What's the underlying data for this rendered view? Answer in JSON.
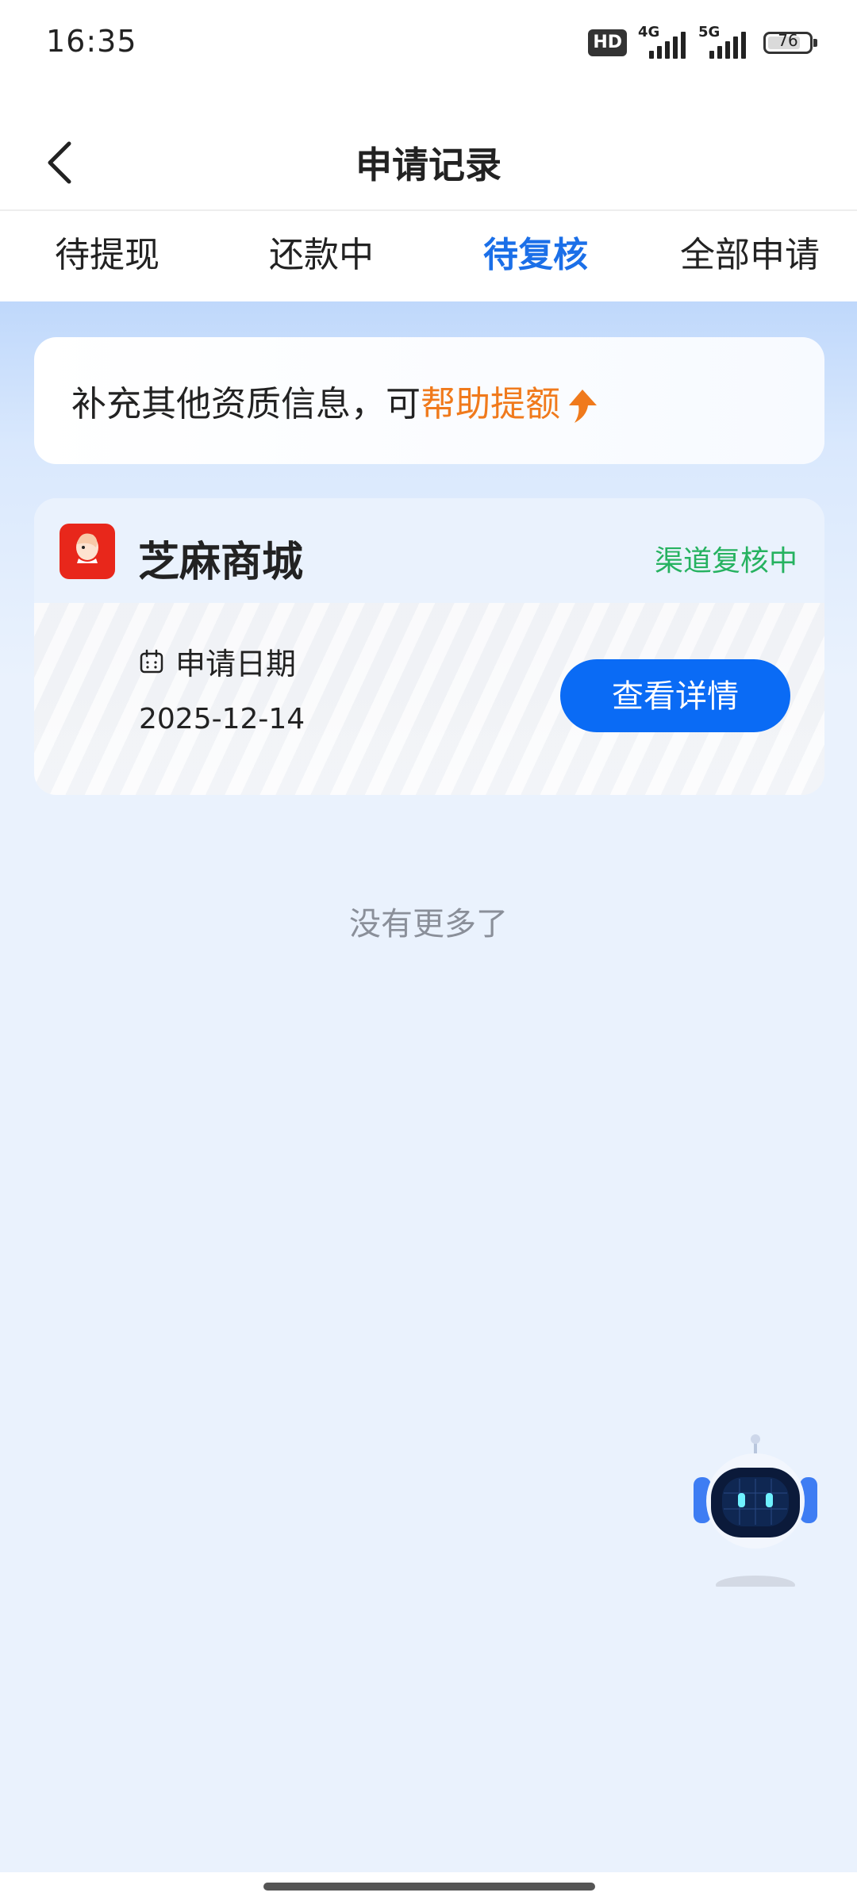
{
  "status_bar": {
    "time": "16:35",
    "hd_label": "HD",
    "net_primary": "4G",
    "net_secondary": "5G",
    "battery": "76"
  },
  "nav": {
    "title": "申请记录",
    "back_icon": "chevron-left-icon"
  },
  "tabs": [
    {
      "label": "待提现",
      "active": false
    },
    {
      "label": "还款中",
      "active": false
    },
    {
      "label": "待复核",
      "active": true
    },
    {
      "label": "全部申请",
      "active": false
    }
  ],
  "promo": {
    "text": "补充其他资质信息，可",
    "highlight": "帮助提额",
    "icon": "arrow-up-icon",
    "highlight_color": "#f07a1c"
  },
  "application": {
    "app_name": "芝麻商城",
    "logo_text": "芝麻商城",
    "status": "渠道复核中",
    "status_color": "#26b260",
    "date_label": "申请日期",
    "date_value": "2025-12-14",
    "button_label": "查看详情",
    "button_color": "#0a6bf5"
  },
  "list_footer": "没有更多了",
  "colors": {
    "accent": "#1b6fe8",
    "background": "#eaf2fd"
  },
  "assistant": {
    "icon": "robot-assistant-icon"
  }
}
